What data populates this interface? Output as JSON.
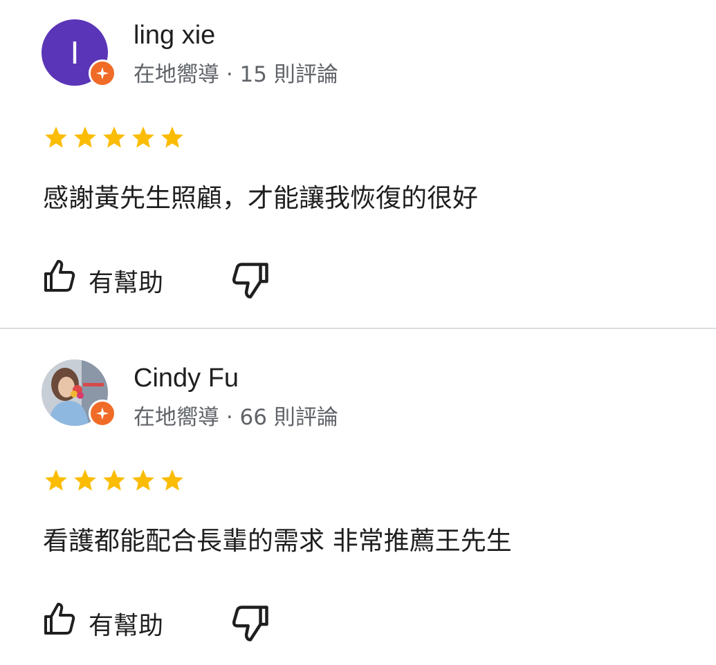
{
  "reviews": [
    {
      "avatar_letter": "I",
      "author": "ling xie",
      "meta": "在地嚮導 · 15 則評論",
      "rating": 5,
      "text": "感謝黃先生照顧，才能讓我恢復的很好",
      "helpful_label": "有幫助"
    },
    {
      "avatar_letter": "",
      "author": "Cindy Fu",
      "meta": "在地嚮導 · 66 則評論",
      "rating": 5,
      "text": "看護都能配合長輩的需求 非常推薦王先生",
      "helpful_label": "有幫助"
    }
  ],
  "colors": {
    "star": "#fbbc04",
    "badge": "#f06b27",
    "avatar_purple": "#5b35b8",
    "divider": "#dadce0"
  },
  "icons": [
    "local-guide-badge-icon",
    "star-icon",
    "thumbs-up-icon",
    "thumbs-down-icon"
  ]
}
